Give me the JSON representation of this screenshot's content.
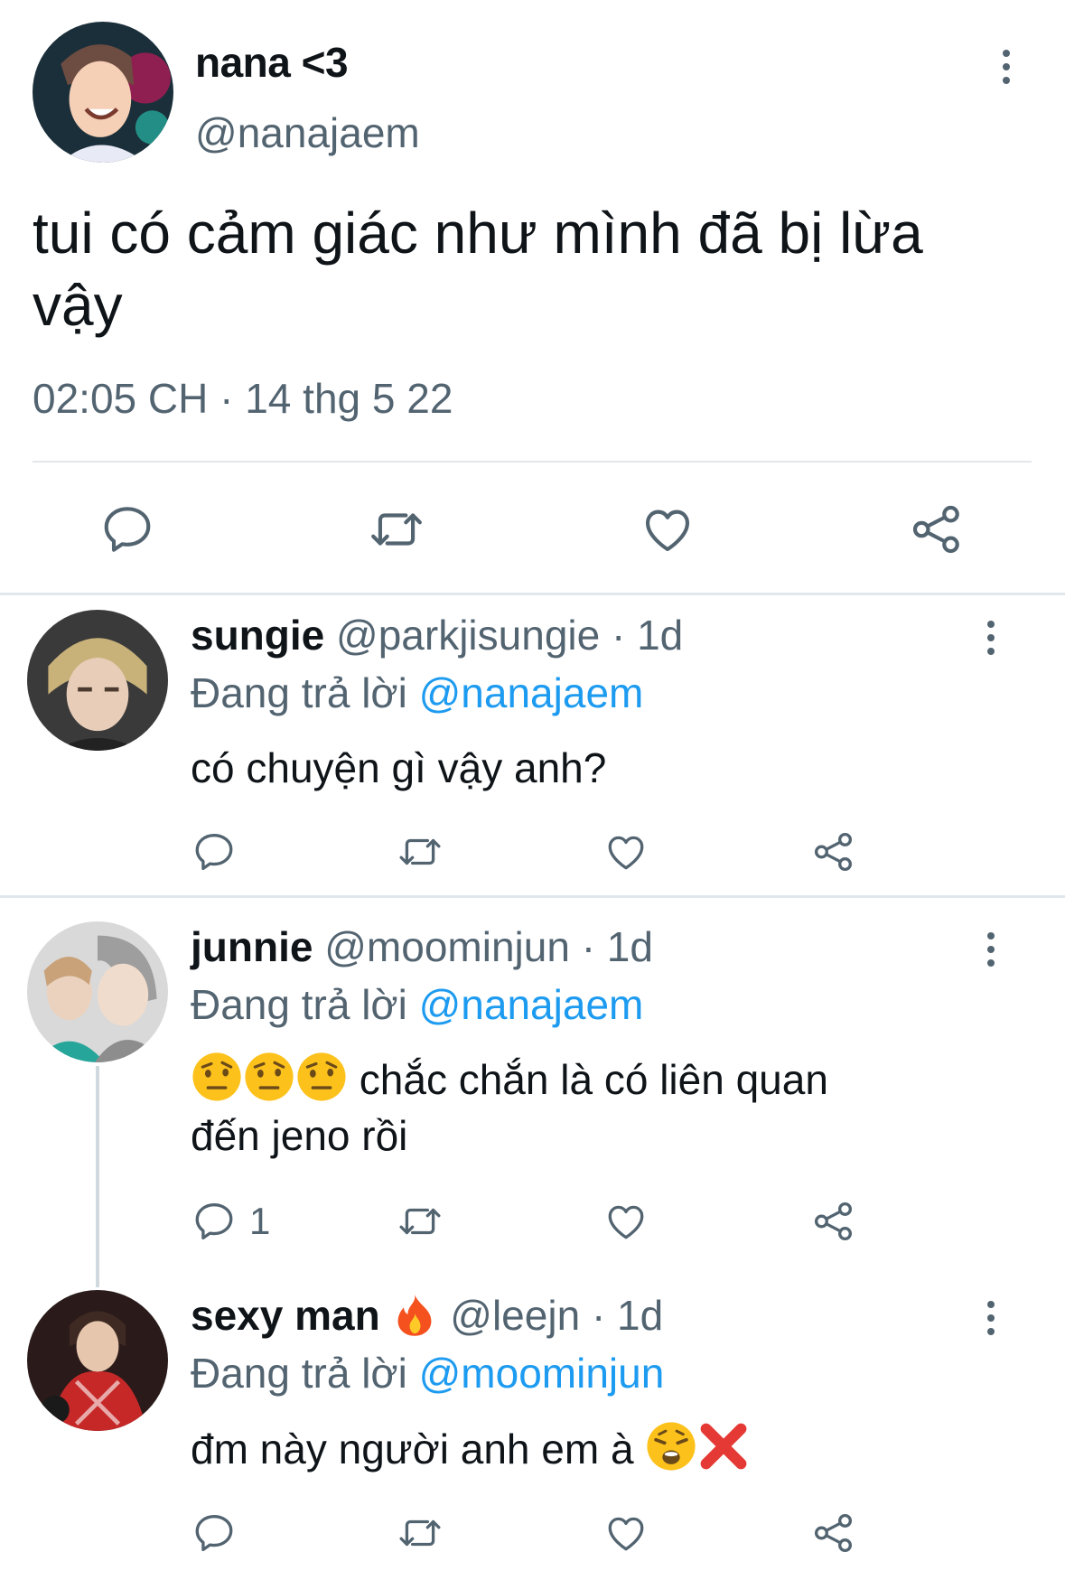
{
  "main_tweet": {
    "name": "nana <3",
    "handle": "@nanajaem",
    "text": "tui có cảm giác như mình đã bị lừa vậy",
    "timestamp": "02:05 CH · 14 thg 5 22",
    "actions": [
      "reply-icon",
      "retweet-icon",
      "like-icon",
      "share-icon"
    ]
  },
  "replies": [
    {
      "name": "sungie",
      "handle": "@parkjisungie",
      "time": "· 1d",
      "replying_prefix": "Đang trả lời",
      "replying_to": "@nanajaem",
      "text": "có chuyện gì vậy anh?",
      "reply_count": ""
    },
    {
      "name": "junnie",
      "handle": "@moominjun",
      "time": "· 1d",
      "replying_prefix": "Đang trả lời",
      "replying_to": "@nanajaem",
      "text_line1": "chắc chắn là có liên quan",
      "text_line2": "đến jeno rồi",
      "emojis": [
        "raised-eyebrow-emoji",
        "raised-eyebrow-emoji",
        "raised-eyebrow-emoji"
      ],
      "reply_count": "1"
    },
    {
      "name": "sexy man",
      "name_emoji": "fire-emoji",
      "handle": "@leejn",
      "time": "· 1d",
      "replying_prefix": "Đang trả lời",
      "replying_to": "@moominjun",
      "text": "đm này người anh em à",
      "emojis": [
        "weary-face-emoji",
        "cross-mark-emoji"
      ],
      "reply_count": ""
    }
  ],
  "colors": {
    "text": "#0f1419",
    "secondary": "#536471",
    "mention": "#1d9bf0",
    "divider": "#e1e8ed"
  }
}
